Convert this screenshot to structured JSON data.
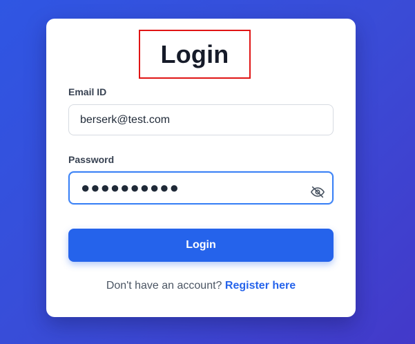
{
  "login_card": {
    "title": "Login",
    "email": {
      "label": "Email ID",
      "value": "berserk@test.com"
    },
    "password": {
      "label": "Password",
      "value": "●●●●●●●●●●",
      "toggle_icon": "eye-off-icon"
    },
    "submit_label": "Login",
    "footer": {
      "prompt": "Don't have an account?",
      "link_label": "Register here"
    }
  },
  "colors": {
    "background_start": "#2f56e3",
    "background_end": "#4339c9",
    "primary": "#2563eb",
    "highlight_box": "#e01414",
    "focus_border": "#3b82f6"
  }
}
